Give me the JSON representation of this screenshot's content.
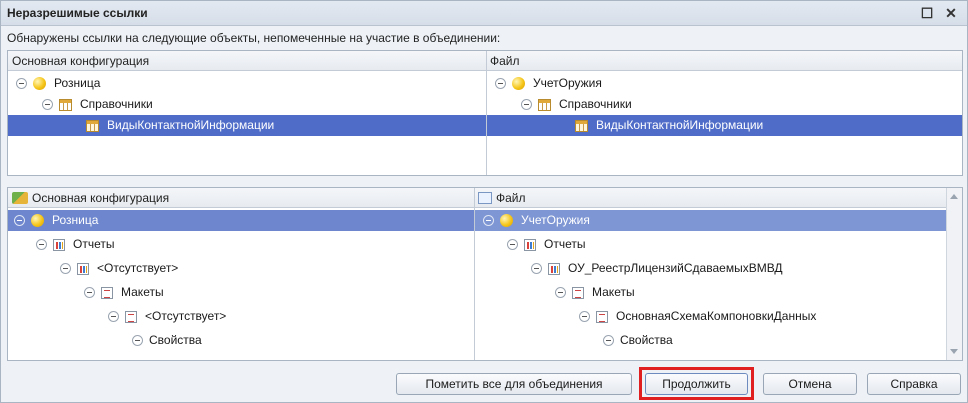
{
  "window": {
    "title": "Неразрешимые ссылки",
    "controls": [
      "maximize-icon",
      "close-icon"
    ]
  },
  "caption": "Обнаружены ссылки на следующие  объекты, непомеченные на участие в объединении:",
  "top_panel": {
    "left_header": "Основная конфигурация",
    "right_header": "Файл",
    "left_rows": [
      {
        "label": "Розница",
        "icon": "ball-icon"
      },
      {
        "label": "Справочники",
        "icon": "catalog-icon"
      },
      {
        "label": "ВидыКонтактнойИнформации",
        "icon": "catalog-icon"
      }
    ],
    "right_rows": [
      {
        "label": "УчетОружия",
        "icon": "ball-icon"
      },
      {
        "label": "Справочники",
        "icon": "catalog-icon"
      },
      {
        "label": "ВидыКонтактнойИнформации",
        "icon": "catalog-icon"
      }
    ]
  },
  "bottom_panel": {
    "left_header": "Основная конфигурация",
    "right_header": "Файл",
    "left_rows": [
      {
        "label": "Розница",
        "icon": "ball-icon"
      },
      {
        "label": "Отчеты",
        "icon": "report-icon"
      },
      {
        "label": "<Отсутствует>",
        "icon": "report-icon"
      },
      {
        "label": "Макеты",
        "icon": "template-icon"
      },
      {
        "label": "<Отсутствует>",
        "icon": "template-icon"
      },
      {
        "label": "Свойства",
        "icon": ""
      }
    ],
    "right_rows": [
      {
        "label": "УчетОружия",
        "icon": "ball-icon"
      },
      {
        "label": "Отчеты",
        "icon": "report-icon"
      },
      {
        "label": "ОУ_РеестрЛицензийСдаваемыхВМВД",
        "icon": "report-icon"
      },
      {
        "label": "Макеты",
        "icon": "template-icon"
      },
      {
        "label": "ОсновнаяСхемаКомпоновкиДанных",
        "icon": "template-icon"
      },
      {
        "label": "Свойства",
        "icon": ""
      }
    ]
  },
  "buttons": {
    "mark_all": "Пометить все для объединения",
    "continue": "Продолжить",
    "cancel": "Отмена",
    "help": "Справка"
  },
  "colors": {
    "selection": "#4f6cc8",
    "highlight_frame": "#e02020"
  }
}
